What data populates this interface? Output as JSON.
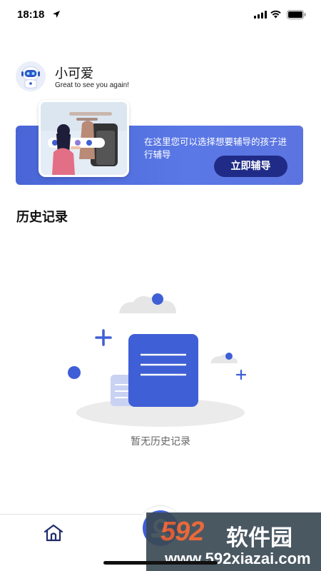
{
  "status_bar": {
    "time": "18:18"
  },
  "profile": {
    "name": "小可爱",
    "greeting": "Great to see you again!"
  },
  "banner": {
    "text": "在这里您可以选择想要辅导的孩子进行辅导",
    "button_label": "立即辅导"
  },
  "history": {
    "title": "历史记录",
    "empty_text": "暂无历史记录"
  },
  "nav": {
    "items": [
      {
        "icon": "home-icon"
      },
      {
        "icon": "center-tab-icon"
      }
    ]
  },
  "watermark": {
    "logo": "592",
    "name": "软件园",
    "url": "www.592xiazai.com"
  },
  "colors": {
    "accent": "#4965d6",
    "button": "#1f2b86"
  }
}
